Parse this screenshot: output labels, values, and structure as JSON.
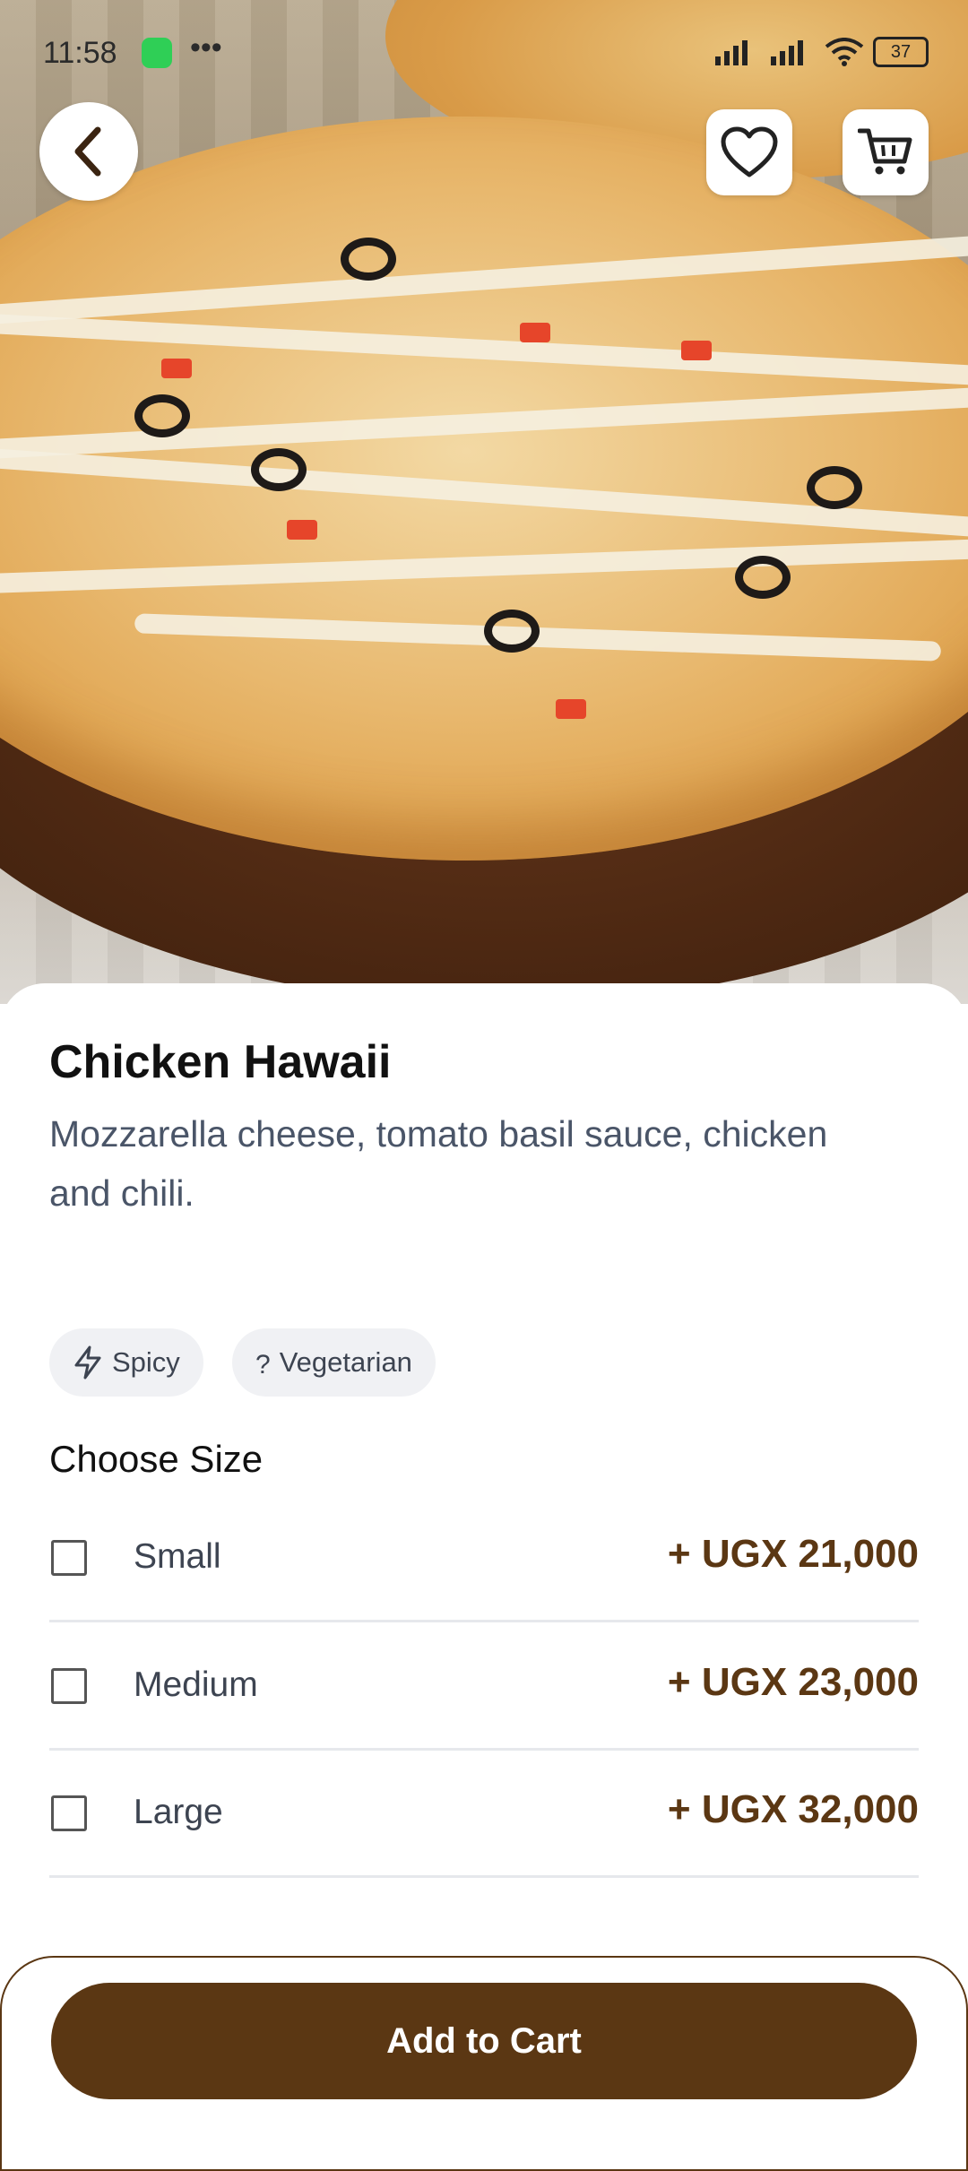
{
  "status_bar": {
    "time": "11:58",
    "battery": "37"
  },
  "header": {
    "back_icon": "chevron-left-icon",
    "favorite_icon": "heart-outline-icon",
    "cart_icon": "cart-icon"
  },
  "product": {
    "name": "Chicken Hawaii",
    "description": "Mozzarella cheese, tomato basil sauce, chicken and chili."
  },
  "tags": [
    {
      "label": "Spicy",
      "icon": "lightning-icon"
    },
    {
      "label": "Vegetarian",
      "icon": "question-icon"
    }
  ],
  "size_section": {
    "title": "Choose Size",
    "options": [
      {
        "label": "Small",
        "price": "+ UGX 21,000",
        "checked": false
      },
      {
        "label": "Medium",
        "price": "+ UGX 23,000",
        "checked": false
      },
      {
        "label": "Large",
        "price": "+ UGX 32,000",
        "checked": false
      }
    ]
  },
  "action": {
    "add_to_cart": "Add to Cart"
  },
  "colors": {
    "brand": "#5b3713",
    "muted_text": "#4a5568",
    "chip_bg": "#f0f1f4"
  }
}
